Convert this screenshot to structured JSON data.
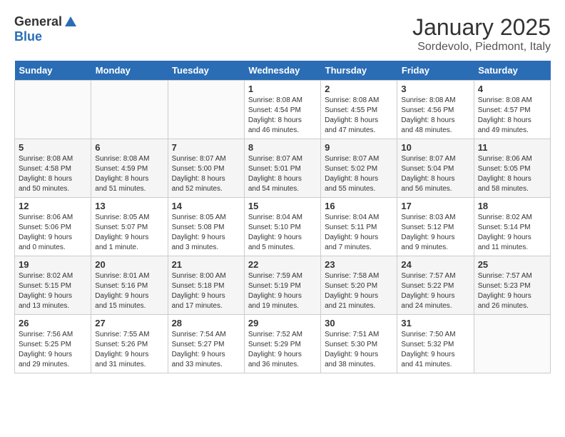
{
  "header": {
    "logo_general": "General",
    "logo_blue": "Blue",
    "month_title": "January 2025",
    "location": "Sordevolo, Piedmont, Italy"
  },
  "weekdays": [
    "Sunday",
    "Monday",
    "Tuesday",
    "Wednesday",
    "Thursday",
    "Friday",
    "Saturday"
  ],
  "weeks": [
    [
      {
        "day": "",
        "detail": ""
      },
      {
        "day": "",
        "detail": ""
      },
      {
        "day": "",
        "detail": ""
      },
      {
        "day": "1",
        "detail": "Sunrise: 8:08 AM\nSunset: 4:54 PM\nDaylight: 8 hours\nand 46 minutes."
      },
      {
        "day": "2",
        "detail": "Sunrise: 8:08 AM\nSunset: 4:55 PM\nDaylight: 8 hours\nand 47 minutes."
      },
      {
        "day": "3",
        "detail": "Sunrise: 8:08 AM\nSunset: 4:56 PM\nDaylight: 8 hours\nand 48 minutes."
      },
      {
        "day": "4",
        "detail": "Sunrise: 8:08 AM\nSunset: 4:57 PM\nDaylight: 8 hours\nand 49 minutes."
      }
    ],
    [
      {
        "day": "5",
        "detail": "Sunrise: 8:08 AM\nSunset: 4:58 PM\nDaylight: 8 hours\nand 50 minutes."
      },
      {
        "day": "6",
        "detail": "Sunrise: 8:08 AM\nSunset: 4:59 PM\nDaylight: 8 hours\nand 51 minutes."
      },
      {
        "day": "7",
        "detail": "Sunrise: 8:07 AM\nSunset: 5:00 PM\nDaylight: 8 hours\nand 52 minutes."
      },
      {
        "day": "8",
        "detail": "Sunrise: 8:07 AM\nSunset: 5:01 PM\nDaylight: 8 hours\nand 54 minutes."
      },
      {
        "day": "9",
        "detail": "Sunrise: 8:07 AM\nSunset: 5:02 PM\nDaylight: 8 hours\nand 55 minutes."
      },
      {
        "day": "10",
        "detail": "Sunrise: 8:07 AM\nSunset: 5:04 PM\nDaylight: 8 hours\nand 56 minutes."
      },
      {
        "day": "11",
        "detail": "Sunrise: 8:06 AM\nSunset: 5:05 PM\nDaylight: 8 hours\nand 58 minutes."
      }
    ],
    [
      {
        "day": "12",
        "detail": "Sunrise: 8:06 AM\nSunset: 5:06 PM\nDaylight: 9 hours\nand 0 minutes."
      },
      {
        "day": "13",
        "detail": "Sunrise: 8:05 AM\nSunset: 5:07 PM\nDaylight: 9 hours\nand 1 minute."
      },
      {
        "day": "14",
        "detail": "Sunrise: 8:05 AM\nSunset: 5:08 PM\nDaylight: 9 hours\nand 3 minutes."
      },
      {
        "day": "15",
        "detail": "Sunrise: 8:04 AM\nSunset: 5:10 PM\nDaylight: 9 hours\nand 5 minutes."
      },
      {
        "day": "16",
        "detail": "Sunrise: 8:04 AM\nSunset: 5:11 PM\nDaylight: 9 hours\nand 7 minutes."
      },
      {
        "day": "17",
        "detail": "Sunrise: 8:03 AM\nSunset: 5:12 PM\nDaylight: 9 hours\nand 9 minutes."
      },
      {
        "day": "18",
        "detail": "Sunrise: 8:02 AM\nSunset: 5:14 PM\nDaylight: 9 hours\nand 11 minutes."
      }
    ],
    [
      {
        "day": "19",
        "detail": "Sunrise: 8:02 AM\nSunset: 5:15 PM\nDaylight: 9 hours\nand 13 minutes."
      },
      {
        "day": "20",
        "detail": "Sunrise: 8:01 AM\nSunset: 5:16 PM\nDaylight: 9 hours\nand 15 minutes."
      },
      {
        "day": "21",
        "detail": "Sunrise: 8:00 AM\nSunset: 5:18 PM\nDaylight: 9 hours\nand 17 minutes."
      },
      {
        "day": "22",
        "detail": "Sunrise: 7:59 AM\nSunset: 5:19 PM\nDaylight: 9 hours\nand 19 minutes."
      },
      {
        "day": "23",
        "detail": "Sunrise: 7:58 AM\nSunset: 5:20 PM\nDaylight: 9 hours\nand 21 minutes."
      },
      {
        "day": "24",
        "detail": "Sunrise: 7:57 AM\nSunset: 5:22 PM\nDaylight: 9 hours\nand 24 minutes."
      },
      {
        "day": "25",
        "detail": "Sunrise: 7:57 AM\nSunset: 5:23 PM\nDaylight: 9 hours\nand 26 minutes."
      }
    ],
    [
      {
        "day": "26",
        "detail": "Sunrise: 7:56 AM\nSunset: 5:25 PM\nDaylight: 9 hours\nand 29 minutes."
      },
      {
        "day": "27",
        "detail": "Sunrise: 7:55 AM\nSunset: 5:26 PM\nDaylight: 9 hours\nand 31 minutes."
      },
      {
        "day": "28",
        "detail": "Sunrise: 7:54 AM\nSunset: 5:27 PM\nDaylight: 9 hours\nand 33 minutes."
      },
      {
        "day": "29",
        "detail": "Sunrise: 7:52 AM\nSunset: 5:29 PM\nDaylight: 9 hours\nand 36 minutes."
      },
      {
        "day": "30",
        "detail": "Sunrise: 7:51 AM\nSunset: 5:30 PM\nDaylight: 9 hours\nand 38 minutes."
      },
      {
        "day": "31",
        "detail": "Sunrise: 7:50 AM\nSunset: 5:32 PM\nDaylight: 9 hours\nand 41 minutes."
      },
      {
        "day": "",
        "detail": ""
      }
    ]
  ]
}
